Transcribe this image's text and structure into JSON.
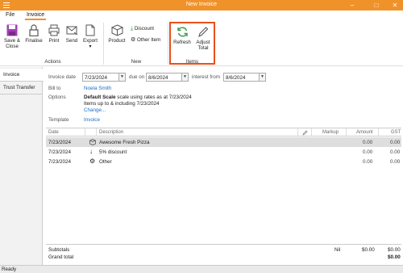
{
  "window": {
    "title": "New Invoice",
    "minimize": "–",
    "maximize": "□",
    "close": "✕"
  },
  "menu": {
    "file": "File",
    "invoice": "Invoice"
  },
  "ribbon": {
    "save_close": [
      "Save &",
      "Close"
    ],
    "finalise": "Finalise",
    "print": "Print",
    "send": "Send",
    "export": "Export",
    "export_arrow": "▾",
    "actions_label": "Actions",
    "product": "Product",
    "discount": "Discount",
    "other_item": "Other Item",
    "new_label": "New",
    "refresh": "Refresh",
    "adjust_total": [
      "Adjust",
      "Total"
    ],
    "items_label": "Items",
    "accent_color": "#f0922a",
    "highlight_color": "#e8501c"
  },
  "sidetabs": {
    "invoice": "Invoice",
    "trust_transfer": "Trust Transfer"
  },
  "form": {
    "invoice_date_label": "Invoice date",
    "invoice_date": "7/23/2024",
    "due_on_label": "due on",
    "due_on": "8/6/2024",
    "interest_from_label": "interest from",
    "interest_from": "8/6/2024",
    "bill_to_label": "Bill to",
    "bill_to": "Noela Smith",
    "options_label": "Options",
    "options_bold": "Default Scale",
    "options_rest": " scale using rates as at 7/23/2024",
    "options_line2": "Items up to & including 7/23/2024",
    "options_change": "Change...",
    "template_label": "Template",
    "template": "Invoice"
  },
  "table": {
    "headers": {
      "date": "Date",
      "description": "Description",
      "markup": "Markup",
      "amount": "Amount",
      "gst": "GST"
    },
    "rows": [
      {
        "date": "7/23/2024",
        "icon": "pizza-box-icon",
        "description": "Awesome Fresh Pizza",
        "amount": "0.00",
        "gst": "0.00"
      },
      {
        "date": "7/23/2024",
        "icon": "discount-arrow-icon",
        "description": "5% discount",
        "amount": "0.00",
        "gst": "0.00"
      },
      {
        "date": "7/23/2024",
        "icon": "gear-icon",
        "description": "Other",
        "amount": "0.00",
        "gst": "0.00"
      }
    ]
  },
  "totals": {
    "subtotals_label": "Subtotals",
    "subtotals_markup": "Nil",
    "subtotals_amount": "$0.00",
    "subtotals_gst": "$0.00",
    "grand_total_label": "Grand total",
    "grand_total": "$0.00"
  },
  "status": {
    "text": "Ready"
  }
}
